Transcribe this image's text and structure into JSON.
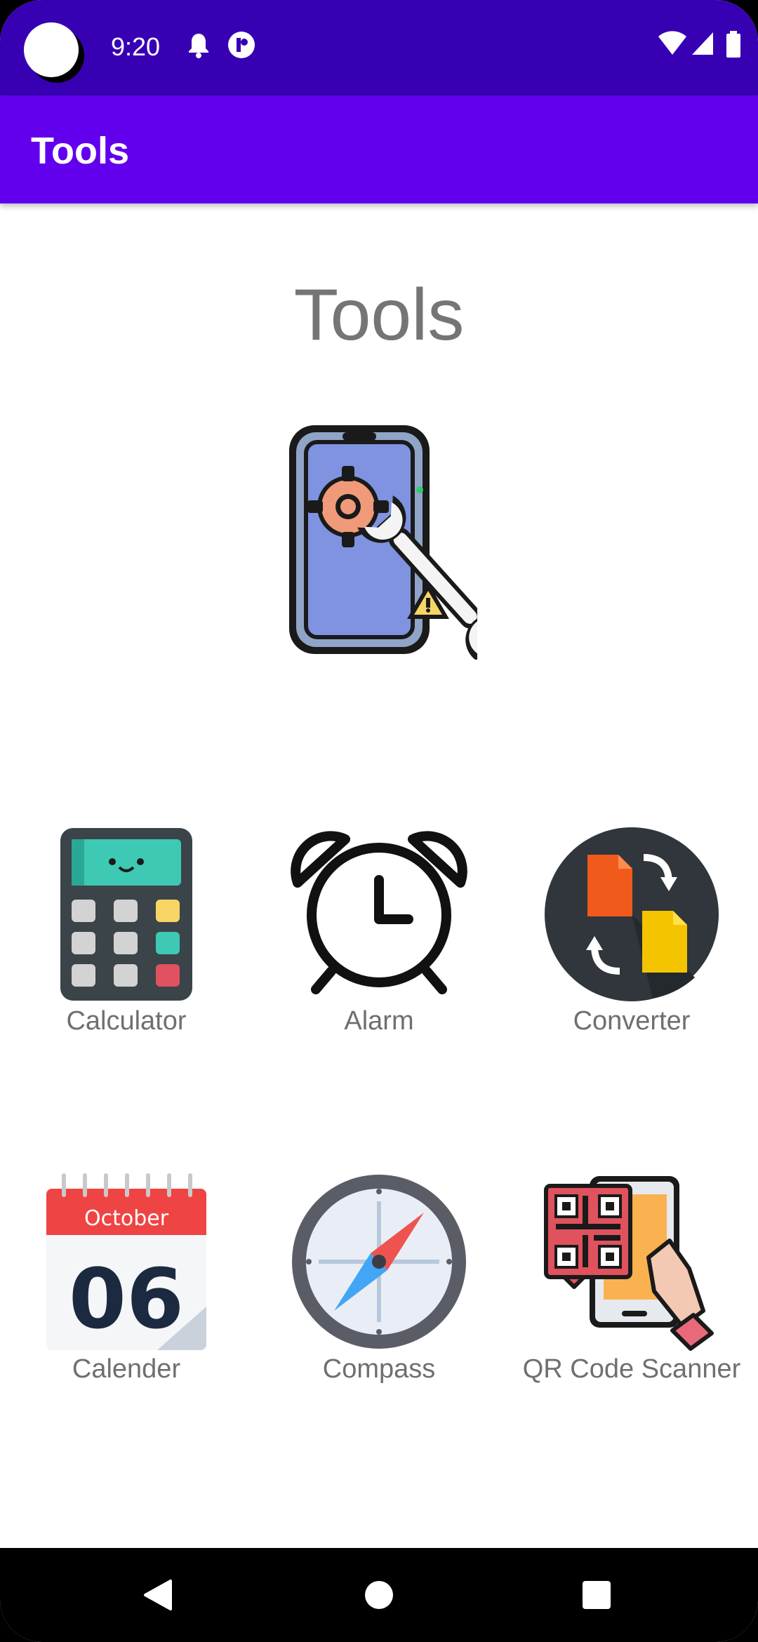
{
  "status_bar": {
    "time": "9:20"
  },
  "app_bar": {
    "title": "Tools"
  },
  "main": {
    "heading": "Tools",
    "tools": [
      {
        "label": "Calculator",
        "icon": "calculator-icon"
      },
      {
        "label": "Alarm",
        "icon": "alarm-clock-icon"
      },
      {
        "label": "Converter",
        "icon": "file-converter-icon"
      },
      {
        "label": "Calender",
        "icon": "calendar-icon",
        "calendar_month": "October",
        "calendar_day": "06"
      },
      {
        "label": "Compass",
        "icon": "compass-icon"
      },
      {
        "label": "QR Code Scanner",
        "icon": "qr-scanner-icon"
      }
    ]
  },
  "colors": {
    "status_bar": "#3700b3",
    "app_bar": "#6200ee",
    "label": "#6f6f6f"
  }
}
